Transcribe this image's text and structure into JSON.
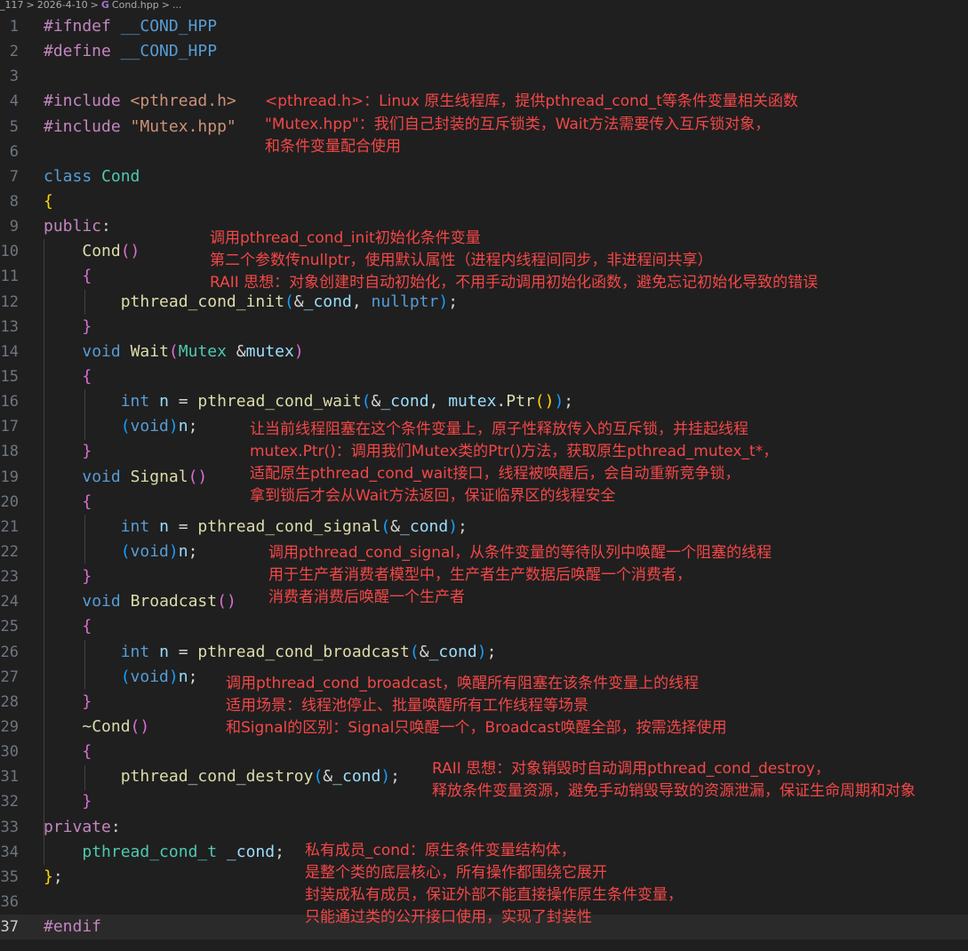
{
  "breadcrumb": [
    "_117",
    ">",
    "2026-4-10",
    ">",
    "G",
    "Cond.hpp",
    ">",
    "..."
  ],
  "code": [
    {
      "n": "1",
      "t": [
        [
          "#ifndef",
          "kw"
        ],
        [
          " "
        ],
        [
          "__COND_HPP",
          "mac"
        ]
      ]
    },
    {
      "n": "2",
      "t": [
        [
          "#define",
          "kw"
        ],
        [
          " "
        ],
        [
          "__COND_HPP",
          "mac"
        ]
      ]
    },
    {
      "n": "3",
      "t": []
    },
    {
      "n": "4",
      "t": [
        [
          "#include",
          "kw"
        ],
        [
          " "
        ],
        [
          "<pthread.h>",
          "str"
        ]
      ]
    },
    {
      "n": "5",
      "t": [
        [
          "#include",
          "kw"
        ],
        [
          " "
        ],
        [
          "\"Mutex.hpp\"",
          "str"
        ]
      ]
    },
    {
      "n": "6",
      "t": []
    },
    {
      "n": "7",
      "t": [
        [
          "class",
          "type"
        ],
        [
          " "
        ],
        [
          "Cond",
          "cls"
        ]
      ]
    },
    {
      "n": "8",
      "t": [
        [
          "{",
          "br1"
        ]
      ]
    },
    {
      "n": "9",
      "t": [
        [
          "public",
          "kw"
        ],
        [
          ":",
          "pl"
        ]
      ]
    },
    {
      "n": "10",
      "t": [
        [
          "    "
        ],
        [
          "Cond",
          "fn"
        ],
        [
          "()",
          "br2"
        ]
      ]
    },
    {
      "n": "11",
      "t": [
        [
          "    "
        ],
        [
          "{",
          "br2"
        ]
      ]
    },
    {
      "n": "12",
      "t": [
        [
          "        "
        ],
        [
          "pthread_cond_init",
          "fn"
        ],
        [
          "(",
          "br3"
        ],
        [
          "&",
          "pl"
        ],
        [
          "_cond",
          "var"
        ],
        [
          ", ",
          "pl"
        ],
        [
          "nullptr",
          "type"
        ],
        [
          ")",
          "br3"
        ],
        [
          ";",
          "pl"
        ]
      ]
    },
    {
      "n": "13",
      "t": [
        [
          "    "
        ],
        [
          "}",
          "br2"
        ]
      ]
    },
    {
      "n": "14",
      "t": [
        [
          "    "
        ],
        [
          "void",
          "type"
        ],
        [
          " "
        ],
        [
          "Wait",
          "fn"
        ],
        [
          "(",
          "br2"
        ],
        [
          "Mutex",
          "cls"
        ],
        [
          " "
        ],
        [
          "&",
          "pl"
        ],
        [
          "mutex",
          "var"
        ],
        [
          ")",
          "br2"
        ]
      ]
    },
    {
      "n": "15",
      "t": [
        [
          "    "
        ],
        [
          "{",
          "br2"
        ]
      ]
    },
    {
      "n": "16",
      "t": [
        [
          "        "
        ],
        [
          "int",
          "type"
        ],
        [
          " "
        ],
        [
          "n",
          "var"
        ],
        [
          " = ",
          "pl"
        ],
        [
          "pthread_cond_wait",
          "fn"
        ],
        [
          "(",
          "br3"
        ],
        [
          "&",
          "pl"
        ],
        [
          "_cond",
          "var"
        ],
        [
          ", ",
          "pl"
        ],
        [
          "mutex",
          "var"
        ],
        [
          ".",
          "pl"
        ],
        [
          "Ptr",
          "fn"
        ],
        [
          "()",
          "br1"
        ],
        [
          ")",
          "br3"
        ],
        [
          ";",
          "pl"
        ]
      ]
    },
    {
      "n": "17",
      "t": [
        [
          "        "
        ],
        [
          "(",
          "br3"
        ],
        [
          "void",
          "type"
        ],
        [
          ")",
          "br3"
        ],
        [
          "n",
          "var"
        ],
        [
          ";",
          "pl"
        ]
      ]
    },
    {
      "n": "18",
      "t": [
        [
          "    "
        ],
        [
          "}",
          "br2"
        ]
      ]
    },
    {
      "n": "19",
      "t": [
        [
          "    "
        ],
        [
          "void",
          "type"
        ],
        [
          " "
        ],
        [
          "Signal",
          "fn"
        ],
        [
          "()",
          "br2"
        ]
      ]
    },
    {
      "n": "20",
      "t": [
        [
          "    "
        ],
        [
          "{",
          "br2"
        ]
      ]
    },
    {
      "n": "21",
      "t": [
        [
          "        "
        ],
        [
          "int",
          "type"
        ],
        [
          " "
        ],
        [
          "n",
          "var"
        ],
        [
          " = ",
          "pl"
        ],
        [
          "pthread_cond_signal",
          "fn"
        ],
        [
          "(",
          "br3"
        ],
        [
          "&",
          "pl"
        ],
        [
          "_cond",
          "var"
        ],
        [
          ")",
          "br3"
        ],
        [
          ";",
          "pl"
        ]
      ]
    },
    {
      "n": "22",
      "t": [
        [
          "        "
        ],
        [
          "(",
          "br3"
        ],
        [
          "void",
          "type"
        ],
        [
          ")",
          "br3"
        ],
        [
          "n",
          "var"
        ],
        [
          ";",
          "pl"
        ]
      ]
    },
    {
      "n": "23",
      "t": [
        [
          "    "
        ],
        [
          "}",
          "br2"
        ]
      ]
    },
    {
      "n": "24",
      "t": [
        [
          "    "
        ],
        [
          "void",
          "type"
        ],
        [
          " "
        ],
        [
          "Broadcast",
          "fn"
        ],
        [
          "()",
          "br2"
        ]
      ]
    },
    {
      "n": "25",
      "t": [
        [
          "    "
        ],
        [
          "{",
          "br2"
        ]
      ]
    },
    {
      "n": "26",
      "t": [
        [
          "        "
        ],
        [
          "int",
          "type"
        ],
        [
          " "
        ],
        [
          "n",
          "var"
        ],
        [
          " = ",
          "pl"
        ],
        [
          "pthread_cond_broadcast",
          "fn"
        ],
        [
          "(",
          "br3"
        ],
        [
          "&",
          "pl"
        ],
        [
          "_cond",
          "var"
        ],
        [
          ")",
          "br3"
        ],
        [
          ";",
          "pl"
        ]
      ]
    },
    {
      "n": "27",
      "t": [
        [
          "        "
        ],
        [
          "(",
          "br3"
        ],
        [
          "void",
          "type"
        ],
        [
          ")",
          "br3"
        ],
        [
          "n",
          "var"
        ],
        [
          ";",
          "pl"
        ]
      ]
    },
    {
      "n": "28",
      "t": [
        [
          "    "
        ],
        [
          "}",
          "br2"
        ]
      ]
    },
    {
      "n": "29",
      "t": [
        [
          "    "
        ],
        [
          "~Cond",
          "fn"
        ],
        [
          "()",
          "br2"
        ]
      ]
    },
    {
      "n": "30",
      "t": [
        [
          "    "
        ],
        [
          "{",
          "br2"
        ]
      ]
    },
    {
      "n": "31",
      "t": [
        [
          "        "
        ],
        [
          "pthread_cond_destroy",
          "fn"
        ],
        [
          "(",
          "br3"
        ],
        [
          "&",
          "pl"
        ],
        [
          "_cond",
          "var"
        ],
        [
          ")",
          "br3"
        ],
        [
          ";",
          "pl"
        ]
      ]
    },
    {
      "n": "32",
      "t": [
        [
          "    "
        ],
        [
          "}",
          "br2"
        ]
      ]
    },
    {
      "n": "33",
      "t": [
        [
          "private",
          "kw"
        ],
        [
          ":",
          "pl"
        ]
      ]
    },
    {
      "n": "34",
      "t": [
        [
          "    "
        ],
        [
          "pthread_cond_t",
          "cls"
        ],
        [
          " "
        ],
        [
          "_cond",
          "var"
        ],
        [
          ";",
          "pl"
        ]
      ]
    },
    {
      "n": "35",
      "t": [
        [
          "}",
          "br1"
        ],
        [
          ";",
          "pl"
        ]
      ]
    },
    {
      "n": "36",
      "t": []
    },
    {
      "n": "37",
      "t": [
        [
          "#endif",
          "kw"
        ]
      ]
    }
  ],
  "notes": [
    "<pthread.h>：Linux 原生线程库，提供pthread_cond_t等条件变量相关函数",
    "\"Mutex.hpp\"：我们自己封装的互斥锁类，Wait方法需要传入互斥锁对象，\n和条件变量配合使用",
    "调用pthread_cond_init初始化条件变量\n第二个参数传nullptr，使用默认属性（进程内线程间同步，非进程间共享）\nRAII 思想：对象创建时自动初始化，不用手动调用初始化函数，避免忘记初始化导致的错误",
    "让当前线程阻塞在这个条件变量上，原子性释放传入的互斥锁，并挂起线程\nmutex.Ptr()：调用我们Mutex类的Ptr()方法，获取原生pthread_mutex_t*，\n适配原生pthread_cond_wait接口，线程被唤醒后，会自动重新竞争锁，\n拿到锁后才会从Wait方法返回，保证临界区的线程安全",
    "调用pthread_cond_signal，从条件变量的等待队列中唤醒一个阻塞的线程\n用于生产者消费者模型中，生产者生产数据后唤醒一个消费者，\n消费者消费后唤醒一个生产者",
    "调用pthread_cond_broadcast，唤醒所有阻塞在该条件变量上的线程\n适用场景：线程池停止、批量唤醒所有工作线程等场景\n和Signal的区别：Signal只唤醒一个，Broadcast唤醒全部，按需选择使用",
    "RAII 思想：对象销毁时自动调用pthread_cond_destroy，\n释放条件变量资源，避免手动销毁导致的资源泄漏，保证生命周期和对象",
    "私有成员_cond：原生条件变量结构体，\n是整个类的底层核心，所有操作都围绕它展开\n封装成私有成员，保证外部不能直接操作原生条件变量，\n只能通过类的公开接口使用，实现了封装性"
  ]
}
